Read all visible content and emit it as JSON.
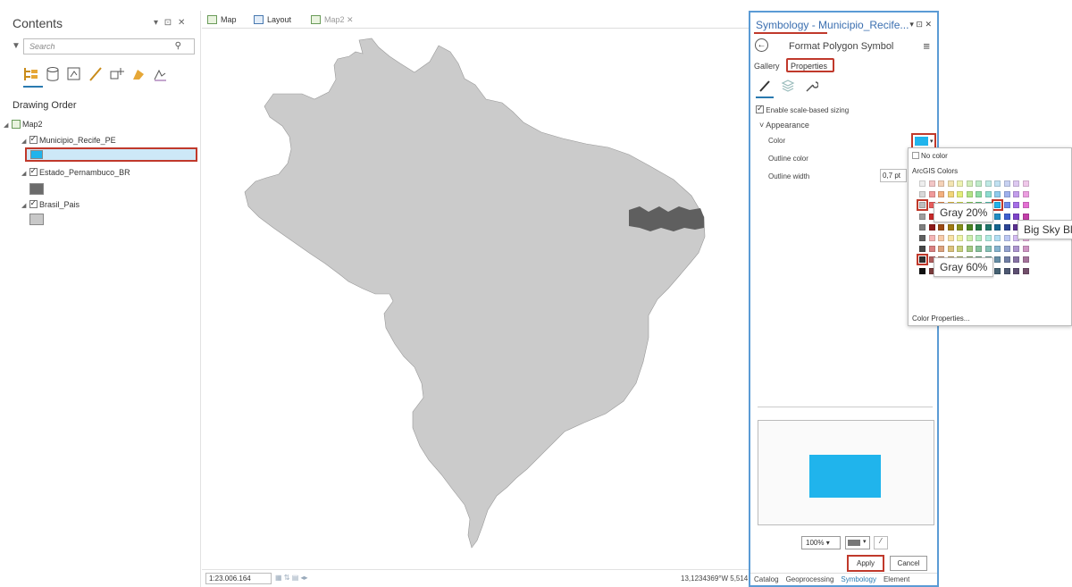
{
  "contents": {
    "title": "Contents",
    "controls": "▾ ⊡ ✕",
    "search_placeholder": "Search",
    "section": "Drawing Order",
    "layers": [
      {
        "name": "Map2",
        "color": ""
      },
      {
        "name": "Municipio_Recife_PE",
        "color": "#20b4ec"
      },
      {
        "name": "Estado_Pernambuco_BR",
        "color": "#6b6b6b"
      },
      {
        "name": "Brasil_Pais",
        "color": "#c8c8c8"
      }
    ]
  },
  "tabs": [
    {
      "label": "Map"
    },
    {
      "label": "Layout"
    },
    {
      "label": "Map2",
      "close": "✕"
    }
  ],
  "statusbar": {
    "scale": "1:23.006.164",
    "coords": "13,1234369°W 5,514"
  },
  "symbology": {
    "title": "Symbology - Municipio_Recife...",
    "controls": "▾ ⊡ ✕",
    "format_title": "Format Polygon Symbol",
    "gallery_tab": "Gallery",
    "properties_tab": "Properties",
    "scale_sizing": "Enable scale-based sizing",
    "appearance": "Appearance",
    "color_label": "Color",
    "outline_color_label": "Outline color",
    "outline_width_label": "Outline width",
    "outline_width_value": "0,7 pt",
    "zoom": "100%",
    "apply": "Apply",
    "cancel": "Cancel",
    "bottom_tabs": [
      "Catalog",
      "Geoprocessing",
      "Symbology",
      "Element"
    ],
    "fill_color": "#20b4ec"
  },
  "color_dropdown": {
    "no_color": "No color",
    "section": "ArcGIS Colors",
    "tip_gray20": "Gray 20%",
    "tip_gray60": "Gray 60%",
    "tip_blue": "Big Sky Blu",
    "color_properties": "Color Properties..."
  },
  "map": {
    "country_color": "#cbcbcb",
    "state_color": "#5f5f5f"
  }
}
